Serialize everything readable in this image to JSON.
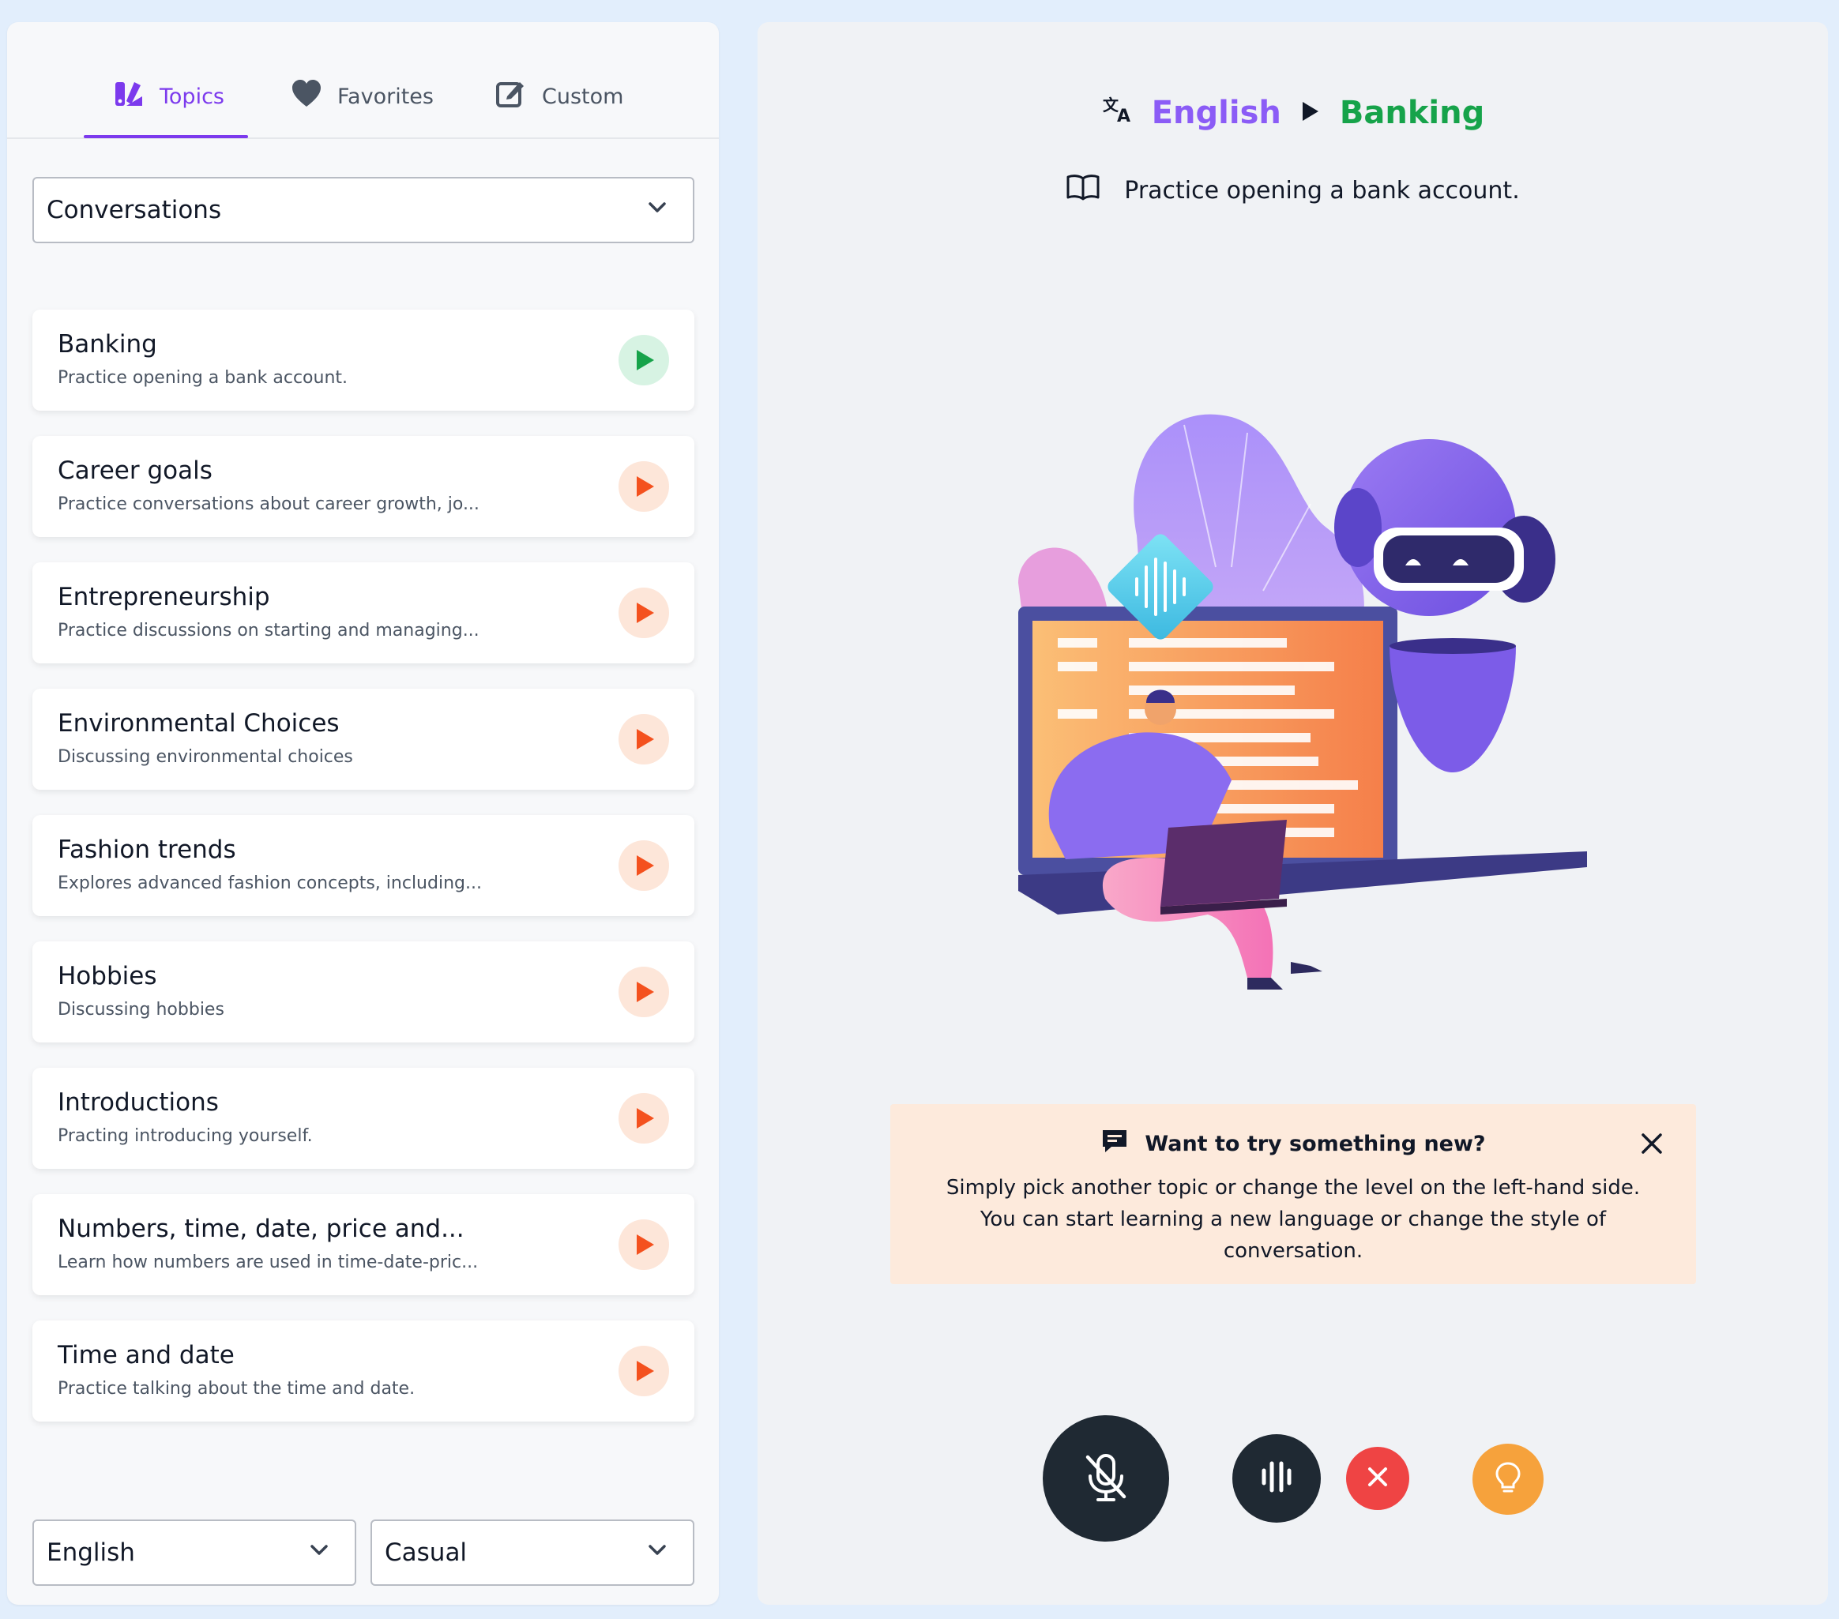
{
  "tabs": [
    {
      "label": "Topics",
      "icon": "topics-icon",
      "active": true
    },
    {
      "label": "Favorites",
      "icon": "heart-icon",
      "active": false
    },
    {
      "label": "Custom",
      "icon": "edit-icon",
      "active": false
    }
  ],
  "category_select": {
    "value": "Conversations"
  },
  "topics": [
    {
      "title": "Banking",
      "desc": "Practice opening a bank account.",
      "active": true
    },
    {
      "title": "Career goals",
      "desc": "Practice conversations about career growth, jo..."
    },
    {
      "title": "Entrepreneurship",
      "desc": "Practice discussions on starting and managing..."
    },
    {
      "title": "Environmental Choices",
      "desc": "Discussing environmental choices"
    },
    {
      "title": "Fashion trends",
      "desc": "Explores advanced fashion concepts, including..."
    },
    {
      "title": "Hobbies",
      "desc": "Discussing hobbies"
    },
    {
      "title": "Introductions",
      "desc": "Practing introducing yourself."
    },
    {
      "title": "Numbers, time, date, price and...",
      "desc": "Learn how numbers are used in time-date-pric..."
    },
    {
      "title": "Time and date",
      "desc": "Practice talking about the time and date."
    }
  ],
  "language_select": {
    "value": "English"
  },
  "style_select": {
    "value": "Casual"
  },
  "header": {
    "language": "English",
    "topic": "Banking",
    "subtitle": "Practice opening a bank account."
  },
  "notice": {
    "title": "Want to try something new?",
    "body": "Simply pick another topic or change the level on the left-hand side. You can start learning a new language or change the style of conversation."
  },
  "colors": {
    "accent": "#7c3aed",
    "topic_green": "#16a34a",
    "play_orange": "#f4511e",
    "stop_red": "#ef4444",
    "hint_orange": "#f6a23c",
    "dark_button": "#1f2933"
  }
}
